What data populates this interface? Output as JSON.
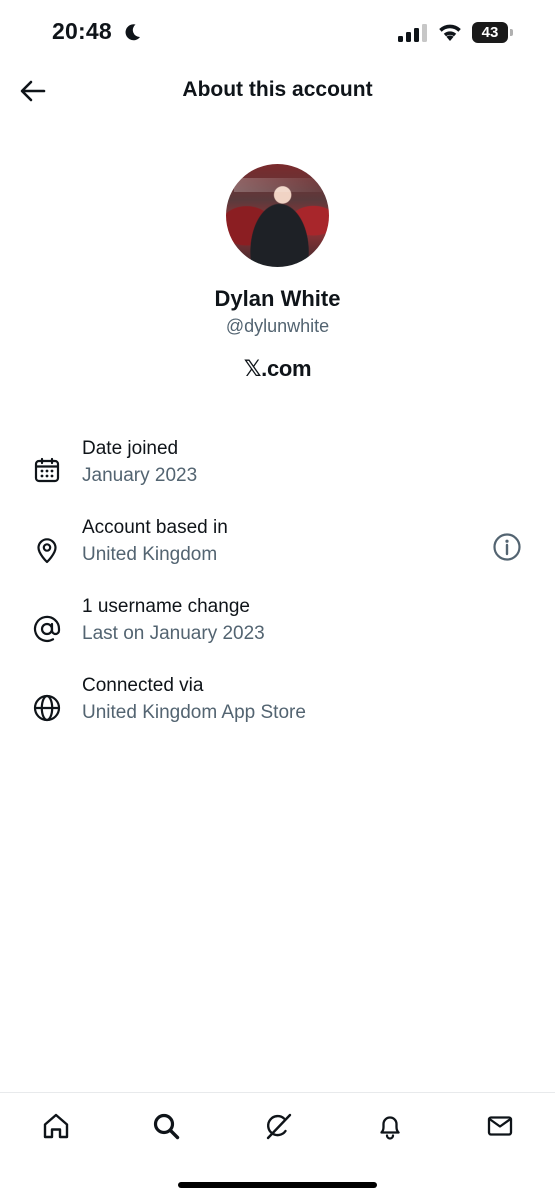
{
  "status_bar": {
    "time": "20:48",
    "battery_level": "43",
    "icons": [
      "moon-icon",
      "signal-icon",
      "wifi-icon",
      "battery-icon"
    ]
  },
  "header": {
    "title": "About this account",
    "back_icon": "back-arrow-icon"
  },
  "profile": {
    "name": "Dylan White",
    "handle": "@dylunwhite",
    "site": "𝕏.com"
  },
  "info": {
    "items": [
      {
        "icon": "calendar-icon",
        "label": "Date joined",
        "value": "January 2023"
      },
      {
        "icon": "location-pin-icon",
        "label": "Account based in",
        "value": "United Kingdom",
        "action_icon": "info-icon"
      },
      {
        "icon": "at-sign-icon",
        "label": "1 username change",
        "value": "Last on January 2023"
      },
      {
        "icon": "globe-icon",
        "label": "Connected via",
        "value": "United Kingdom App Store"
      }
    ]
  },
  "bottom_nav": {
    "items": [
      {
        "icon": "home-icon"
      },
      {
        "icon": "search-icon"
      },
      {
        "icon": "grok-icon"
      },
      {
        "icon": "bell-icon"
      },
      {
        "icon": "mail-icon"
      }
    ]
  },
  "colors": {
    "primary_text": "#0f1419",
    "secondary_text": "#536471",
    "background": "#ffffff",
    "divider": "#e8eaec"
  }
}
